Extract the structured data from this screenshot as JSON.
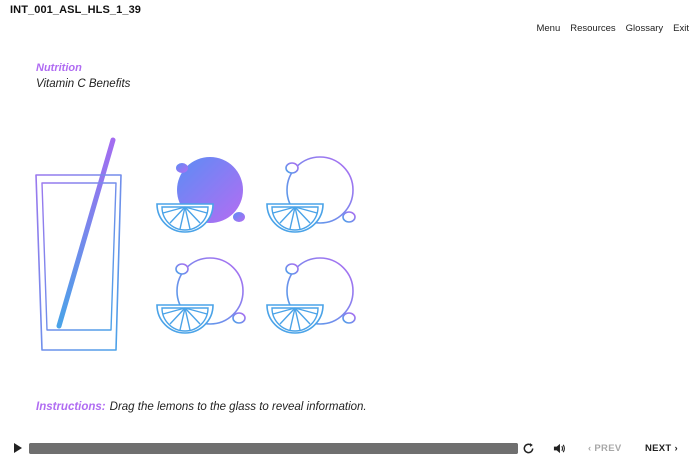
{
  "header": {
    "course_id": "INT_001_ASL_HLS_1_39"
  },
  "nav": {
    "menu": "Menu",
    "resources": "Resources",
    "glossary": "Glossary",
    "exit": "Exit"
  },
  "content": {
    "module": "Nutrition",
    "subtitle": "Vitamin C Benefits",
    "instructions_label": "Instructions:",
    "instructions_text": "Drag the lemons to the glass to reveal information.",
    "lemons": [
      {
        "name": "lemon-1",
        "state": "selected"
      },
      {
        "name": "lemon-2",
        "state": "outline"
      },
      {
        "name": "lemon-3",
        "state": "outline"
      },
      {
        "name": "lemon-4",
        "state": "outline"
      }
    ]
  },
  "player": {
    "progress_percent": 100,
    "prev_label": "PREV",
    "next_label": "NEXT",
    "prev_chevron": "‹",
    "next_chevron": "›",
    "icons": [
      "play-icon",
      "replay-icon",
      "volume-icon"
    ]
  },
  "colors": {
    "accent_purple": "#b06cf2",
    "accent_blue": "#4aa3e8",
    "fill_blue": "#5b8df5",
    "bar_grey": "#8a8a8a"
  }
}
